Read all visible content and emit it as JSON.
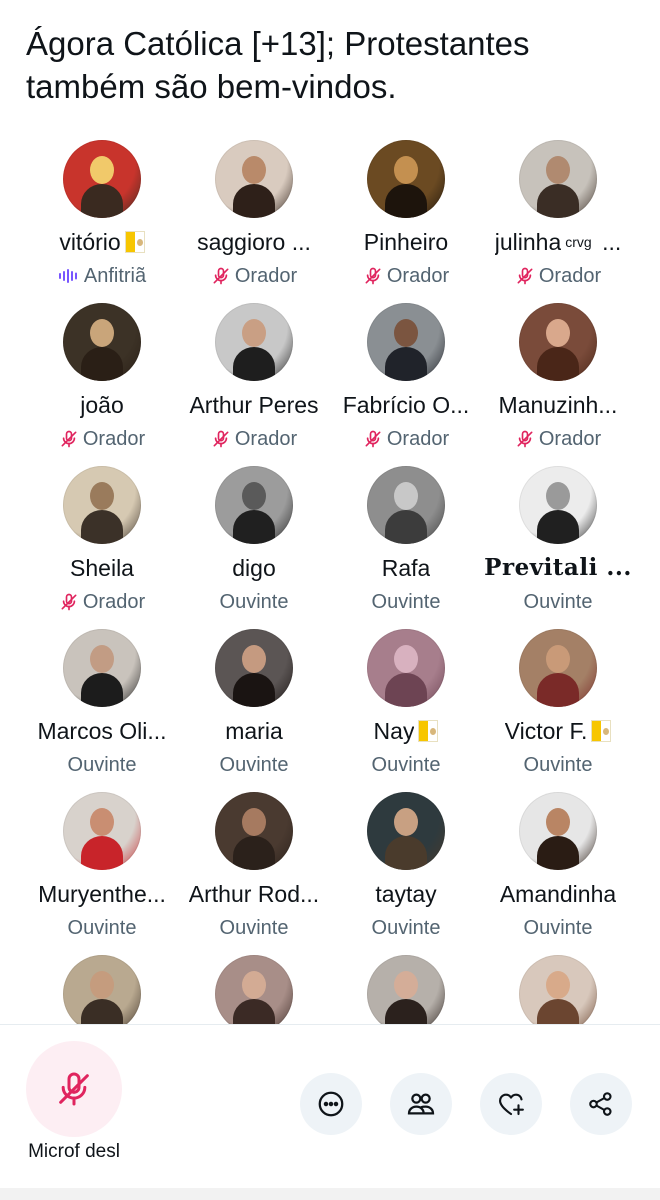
{
  "space": {
    "title": "Ágora Católica [+13]; Protestantes também são bem-vindos."
  },
  "participants": [
    {
      "name": "vitório",
      "flag": true,
      "role": "Anfitriã",
      "role_type": "host",
      "avatar": [
        "#c8342c",
        "#f1c96a",
        "#3a2a20"
      ]
    },
    {
      "name": "saggioro ...",
      "role": "Orador",
      "role_type": "speaker",
      "avatar": [
        "#d9cbbf",
        "#b98a6a",
        "#2e2019"
      ]
    },
    {
      "name": "Pinheiro",
      "role": "Orador",
      "role_type": "speaker",
      "avatar": [
        "#6b4a22",
        "#c49050",
        "#1d140c"
      ]
    },
    {
      "name": "julinha",
      "sup": "crvg",
      "suffix": " ...",
      "role": "Orador",
      "role_type": "speaker",
      "avatar": [
        "#c7c2bb",
        "#b08a70",
        "#3a2d25"
      ]
    },
    {
      "name": "joão",
      "role": "Orador",
      "role_type": "speaker",
      "avatar": [
        "#3c3226",
        "#c9a57a",
        "#2a1f16"
      ]
    },
    {
      "name": "Arthur Peres",
      "role": "Orador",
      "role_type": "speaker",
      "avatar": [
        "#c8c8c8",
        "#c99f84",
        "#1e1e1e"
      ]
    },
    {
      "name": "Fabrício O...",
      "role": "Orador",
      "role_type": "speaker",
      "avatar": [
        "#8a8f93",
        "#7b5540",
        "#20232a"
      ]
    },
    {
      "name": "Manuzinh...",
      "role": "Orador",
      "role_type": "speaker",
      "avatar": [
        "#7a4b3a",
        "#d9a88c",
        "#4a2618"
      ]
    },
    {
      "name": "Sheila",
      "role": "Orador",
      "role_type": "speaker",
      "avatar": [
        "#d6c9b2",
        "#9a7b5c",
        "#3b3128"
      ]
    },
    {
      "name": "digo",
      "role": "Ouvinte",
      "role_type": "listener",
      "avatar": [
        "#9c9c9c",
        "#5a5a5a",
        "#202020"
      ]
    },
    {
      "name": "Rafa",
      "role": "Ouvinte",
      "role_type": "listener",
      "avatar": [
        "#8e8e8e",
        "#c8c8c8",
        "#3c3c3c"
      ]
    },
    {
      "name": "Previtali ...",
      "gothic": true,
      "role": "Ouvinte",
      "role_type": "listener",
      "avatar": [
        "#ececec",
        "#9a9a9a",
        "#202020"
      ]
    },
    {
      "name": "Marcos Oli...",
      "role": "Ouvinte",
      "role_type": "listener",
      "avatar": [
        "#c9c3bc",
        "#c29c84",
        "#1c1c1c"
      ]
    },
    {
      "name": "maria",
      "role": "Ouvinte",
      "role_type": "listener",
      "avatar": [
        "#5b5554",
        "#c59a80",
        "#1a1412"
      ]
    },
    {
      "name": "Nay",
      "flag": true,
      "role": "Ouvinte",
      "role_type": "listener",
      "avatar": [
        "#a77e8c",
        "#d8b1bf",
        "#6d4453"
      ]
    },
    {
      "name": "Victor F.",
      "flag": true,
      "role": "Ouvinte",
      "role_type": "listener",
      "avatar": [
        "#a48066",
        "#c99a78",
        "#7a2a28"
      ]
    },
    {
      "name": "Muryenthe...",
      "role": "Ouvinte",
      "role_type": "listener",
      "avatar": [
        "#d8d2cc",
        "#c98e72",
        "#c8242a"
      ]
    },
    {
      "name": "Arthur Rod...",
      "role": "Ouvinte",
      "role_type": "listener",
      "avatar": [
        "#4a3a30",
        "#a67a60",
        "#2b211b"
      ]
    },
    {
      "name": "taytay",
      "role": "Ouvinte",
      "role_type": "listener",
      "avatar": [
        "#2e3a3e",
        "#c8a082",
        "#4a3b2c"
      ]
    },
    {
      "name": "Amandinha",
      "role": "Ouvinte",
      "role_type": "listener",
      "avatar": [
        "#e6e6e6",
        "#b98564",
        "#2a1c14"
      ]
    },
    {
      "name": "",
      "role": "",
      "role_type": "",
      "avatar": [
        "#b9a990",
        "#c59c7e",
        "#3a2e25"
      ]
    },
    {
      "name": "",
      "role": "",
      "role_type": "",
      "avatar": [
        "#a88e88",
        "#d3ab94",
        "#3b2a25"
      ]
    },
    {
      "name": "",
      "role": "",
      "role_type": "",
      "avatar": [
        "#b6b0aa",
        "#d4ad98",
        "#2b211d"
      ]
    },
    {
      "name": "",
      "role": "",
      "role_type": "",
      "avatar": [
        "#d8c8bc",
        "#d8aa8a",
        "#6b4530"
      ]
    }
  ],
  "controls": {
    "mic_label": "Microf desl",
    "actions": [
      {
        "id": "more",
        "icon": "more-icon"
      },
      {
        "id": "people",
        "icon": "people-icon"
      },
      {
        "id": "react",
        "icon": "heart-plus-icon"
      },
      {
        "id": "share",
        "icon": "share-icon"
      }
    ]
  },
  "colors": {
    "host": "#7856ff",
    "muted": "#e0245e",
    "listener": "#536471",
    "mic_bg": "#fdeef3",
    "action_bg": "#eef3f7"
  }
}
